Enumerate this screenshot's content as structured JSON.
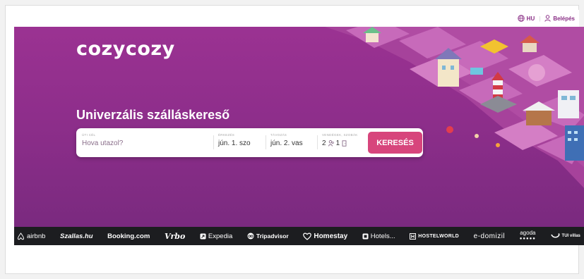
{
  "header": {
    "language": "HU",
    "login": "Belépés"
  },
  "hero": {
    "logo": "cozycozy",
    "headline": "Univerzális szálláskereső"
  },
  "search": {
    "destination_label": "ÚTI CÉL",
    "destination_placeholder": "Hova utazol?",
    "checkin_label": "ÉRKEZÉS",
    "checkin_value": "jún. 1. szo",
    "checkout_label": "TÁVOZÁS",
    "checkout_value": "jún. 2. vas",
    "guests_label": "VENDÉGEK, SZOBÁK",
    "guests_adults": "2",
    "guests_rooms": "1",
    "button_label": "KERESÉS"
  },
  "partners": [
    {
      "name": "airbnb",
      "icon": "airbnb-icon"
    },
    {
      "name": "Szallas.hu"
    },
    {
      "name": "Booking.com"
    },
    {
      "name": "Vrbo"
    },
    {
      "name": "Expedia",
      "icon": "expedia-icon"
    },
    {
      "name": "Tripadvisor",
      "icon": "tripadvisor-icon"
    },
    {
      "name": "Homestay",
      "icon": "homestay-heart-icon"
    },
    {
      "name": "Hotels...",
      "icon": "hotels-icon"
    },
    {
      "name": "HOSTELWORLD",
      "icon": "hostelworld-icon"
    },
    {
      "name": "e-domizil"
    },
    {
      "name": "agoda",
      "dots": "●●●●●"
    },
    {
      "name": "TUI villas",
      "icon": "tui-smile-icon"
    }
  ],
  "colors": {
    "hero_bg": "#9b3292",
    "brand_pink": "#d7457c",
    "partner_bar": "#1c1d20",
    "accent_text": "#8a2f86"
  }
}
